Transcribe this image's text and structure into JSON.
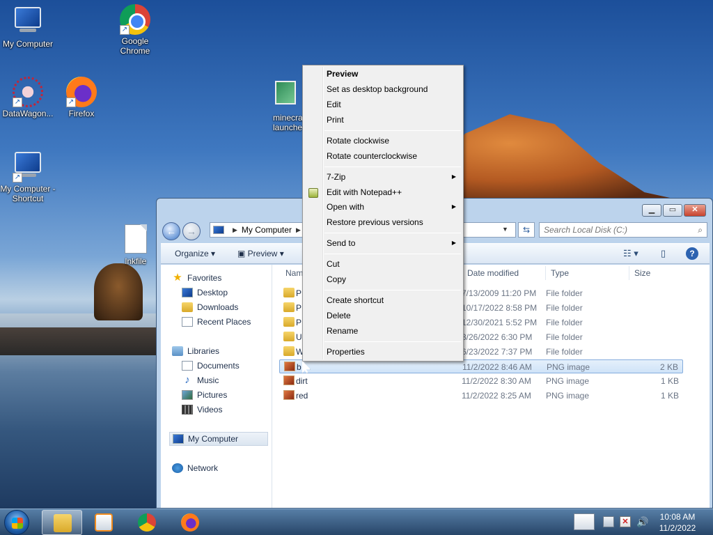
{
  "desktop": {
    "icons": [
      {
        "label": "My Computer",
        "icon": "computer-icon"
      },
      {
        "label": "Google Chrome",
        "icon": "chrome-icon"
      },
      {
        "label": "DataWagon...",
        "icon": "datawagon-icon"
      },
      {
        "label": "Firefox",
        "icon": "firefox-icon"
      },
      {
        "label": "minecra launche",
        "icon": "image-file-icon"
      },
      {
        "label": "My Computer - Shortcut",
        "icon": "computer-icon"
      },
      {
        "label": "lnkfile",
        "icon": "blank-file-icon"
      }
    ]
  },
  "window": {
    "breadcrumb": "My Computer",
    "search_placeholder": "Search Local Disk (C:)",
    "toolbar": {
      "organize": "Organize",
      "preview": "Preview"
    },
    "nav": {
      "favorites": "Favorites",
      "desktop": "Desktop",
      "downloads": "Downloads",
      "recent": "Recent Places",
      "libraries": "Libraries",
      "documents": "Documents",
      "music": "Music",
      "pictures": "Pictures",
      "videos": "Videos",
      "computer": "My Computer",
      "network": "Network"
    },
    "columns": {
      "name": "Nam",
      "date": "Date modified",
      "type": "Type",
      "size": "Size"
    },
    "files": [
      {
        "name": "P",
        "date": "7/13/2009 11:20 PM",
        "type": "File folder",
        "size": "",
        "kind": "folder"
      },
      {
        "name": "P",
        "date": "10/17/2022 8:58 PM",
        "type": "File folder",
        "size": "",
        "kind": "folder"
      },
      {
        "name": "P",
        "date": "12/30/2021 5:52 PM",
        "type": "File folder",
        "size": "",
        "kind": "folder"
      },
      {
        "name": "U",
        "date": "3/26/2022 6:30 PM",
        "type": "File folder",
        "size": "",
        "kind": "folder"
      },
      {
        "name": "W",
        "date": "6/23/2022 7:37 PM",
        "type": "File folder",
        "size": "",
        "kind": "folder"
      },
      {
        "name": "b",
        "date": "11/2/2022 8:46 AM",
        "type": "PNG image",
        "size": "2 KB",
        "kind": "png"
      },
      {
        "name": "dirt",
        "date": "11/2/2022 8:30 AM",
        "type": "PNG image",
        "size": "1 KB",
        "kind": "png"
      },
      {
        "name": "red",
        "date": "11/2/2022 8:25 AM",
        "type": "PNG image",
        "size": "1 KB",
        "kind": "png"
      }
    ]
  },
  "context_menu": {
    "preview": "Preview",
    "set_background": "Set as desktop background",
    "edit": "Edit",
    "print": "Print",
    "rotate_cw": "Rotate clockwise",
    "rotate_ccw": "Rotate counterclockwise",
    "seven_zip": "7-Zip",
    "edit_npp": "Edit with Notepad++",
    "open_with": "Open with",
    "restore": "Restore previous versions",
    "send_to": "Send to",
    "cut": "Cut",
    "copy": "Copy",
    "create_shortcut": "Create shortcut",
    "delete": "Delete",
    "rename": "Rename",
    "properties": "Properties"
  },
  "taskbar": {
    "time": "10:08 AM",
    "date": "11/2/2022"
  }
}
